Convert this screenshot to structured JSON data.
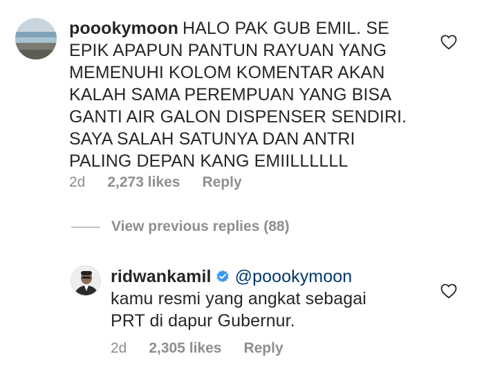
{
  "comment": {
    "username": "poookymoon",
    "lines": [
      "HALO PAK GUB EMIL. SE",
      "EPIK APAPUN PANTUN RAYUAN YANG",
      "MEMENUHI KOLOM KOMENTAR AKAN",
      "KALAH SAMA PEREMPUAN YANG BISA",
      "GANTI AIR GALON DISPENSER SENDIRI.",
      "SAYA SALAH SATUNYA  DAN ANTRI",
      "PALING DEPAN KANG EMIILLLLLL"
    ],
    "time": "2d",
    "likes": "2,273 likes",
    "reply_label": "Reply",
    "avatar_icon": "beach-avatar"
  },
  "replies_toggle": {
    "label": "View previous replies (88)"
  },
  "reply": {
    "username": "ridwankamil",
    "verified_icon": "verified-badge-icon",
    "mention": "@poookymoon",
    "lines": [
      "kamu resmi yang angkat sebagai",
      "PRT di dapur Gubernur."
    ],
    "time": "2d",
    "likes": "2,305 likes",
    "reply_label": "Reply",
    "avatar_icon": "person-avatar"
  },
  "colors": {
    "text": "#262626",
    "muted": "#8e8e8e",
    "verified": "#3897f0",
    "mention": "#00376b"
  }
}
